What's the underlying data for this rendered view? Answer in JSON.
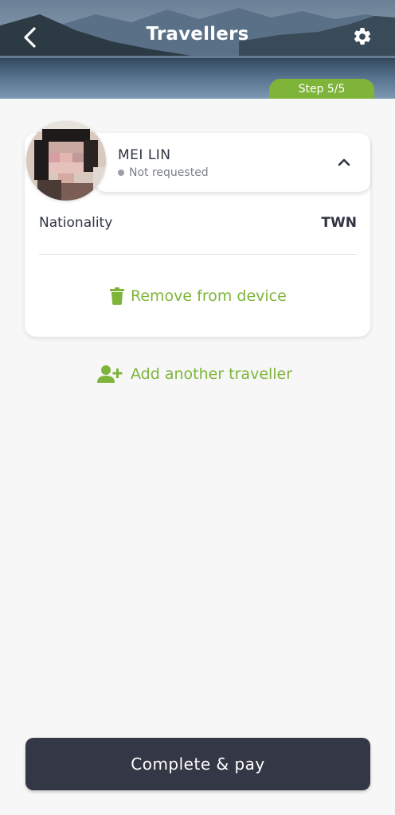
{
  "header": {
    "title": "Travellers",
    "step_label": "Step 5/5",
    "back_icon": "chevron-left-icon",
    "settings_icon": "gear-icon"
  },
  "traveller": {
    "name": "MEI LIN",
    "status": "Not requested",
    "nationality_label": "Nationality",
    "nationality_value": "TWN"
  },
  "actions": {
    "remove_label": "Remove from device",
    "add_label": "Add another traveller",
    "pay_label": "Complete & pay"
  },
  "colors": {
    "accent": "#7fb43a",
    "button_dark": "#343846",
    "background": "#f7f7f8"
  }
}
